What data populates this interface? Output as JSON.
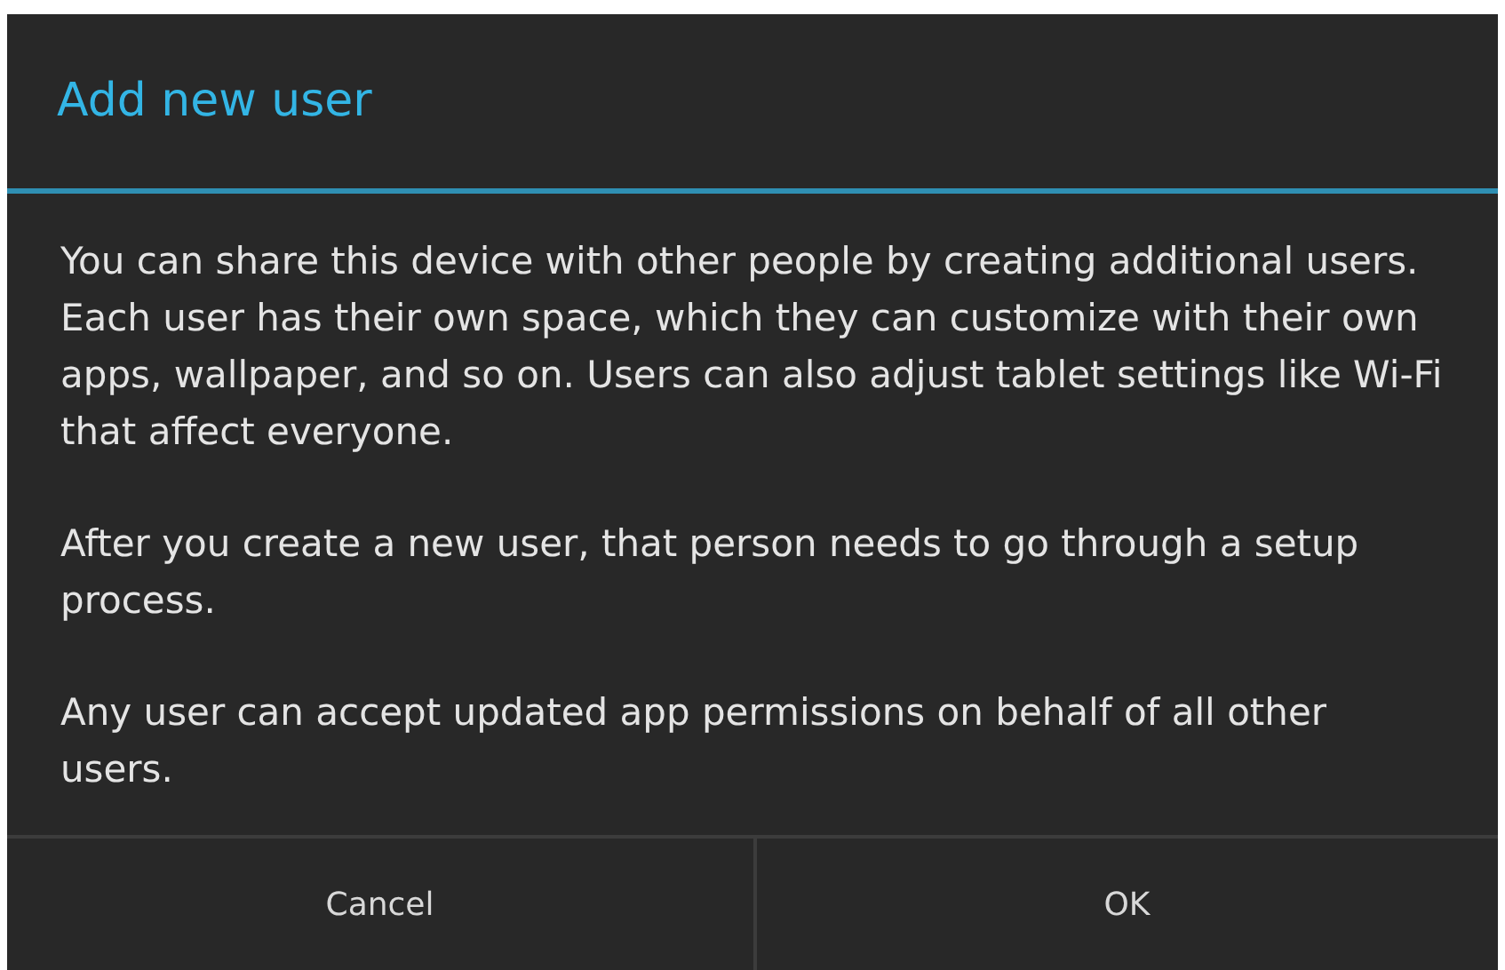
{
  "dialog": {
    "title": "Add new user",
    "paragraphs": [
      "You can share this device with other people by creating additional users. Each user has their own space, which they can customize with their own apps, wallpaper, and so on. Users can also adjust tablet settings like Wi-Fi that affect everyone.",
      "After you create a new user, that person needs to go through a setup process.",
      "Any user can accept updated app permissions on behalf of all other users."
    ],
    "buttons": [
      "Cancel",
      "OK"
    ]
  }
}
